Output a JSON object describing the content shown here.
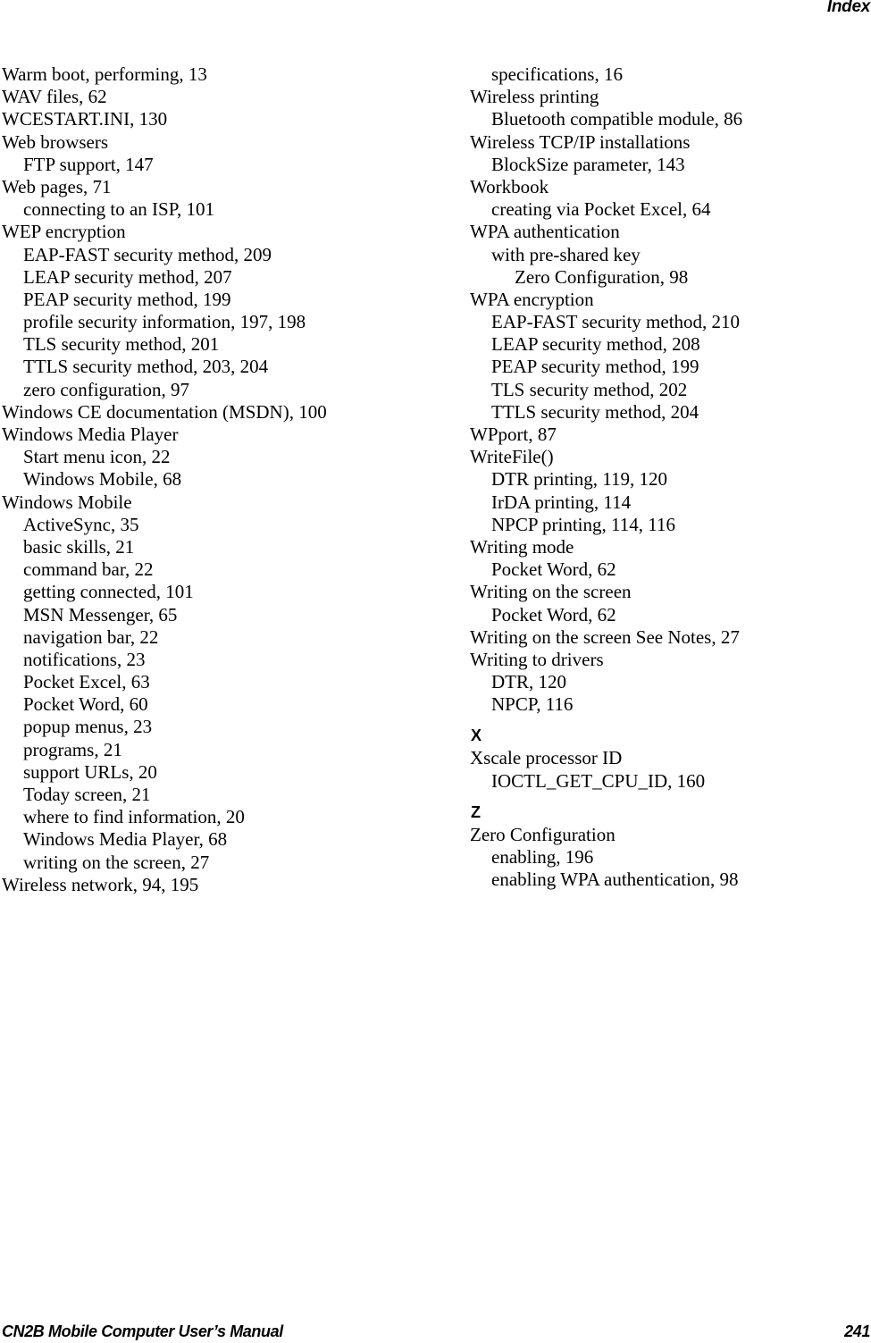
{
  "header": {
    "running_head": "Index"
  },
  "columns": [
    {
      "entries": [
        {
          "level": 1,
          "text": "Warm boot, performing, 13"
        },
        {
          "level": 1,
          "text": "WAV files, 62"
        },
        {
          "level": 1,
          "text": "WCESTART.INI, 130"
        },
        {
          "level": 1,
          "text": "Web browsers"
        },
        {
          "level": 2,
          "text": "FTP support, 147"
        },
        {
          "level": 1,
          "text": "Web pages, 71"
        },
        {
          "level": 2,
          "text": "connecting to an ISP, 101"
        },
        {
          "level": 1,
          "text": "WEP encryption"
        },
        {
          "level": 2,
          "text": "EAP-FAST security method, 209"
        },
        {
          "level": 2,
          "text": "LEAP security method, 207"
        },
        {
          "level": 2,
          "text": "PEAP security method, 199"
        },
        {
          "level": 2,
          "text": "profile security information, 197, 198"
        },
        {
          "level": 2,
          "text": "TLS security method, 201"
        },
        {
          "level": 2,
          "text": "TTLS security method, 203, 204"
        },
        {
          "level": 2,
          "text": "zero configuration, 97"
        },
        {
          "level": 1,
          "text": "Windows CE documentation (MSDN), 100"
        },
        {
          "level": 1,
          "text": "Windows Media Player"
        },
        {
          "level": 2,
          "text": "Start menu icon, 22"
        },
        {
          "level": 2,
          "text": "Windows Mobile, 68"
        },
        {
          "level": 1,
          "text": "Windows Mobile"
        },
        {
          "level": 2,
          "text": "ActiveSync, 35"
        },
        {
          "level": 2,
          "text": "basic skills, 21"
        },
        {
          "level": 2,
          "text": "command bar, 22"
        },
        {
          "level": 2,
          "text": "getting connected, 101"
        },
        {
          "level": 2,
          "text": "MSN Messenger, 65"
        },
        {
          "level": 2,
          "text": "navigation bar, 22"
        },
        {
          "level": 2,
          "text": "notifications, 23"
        },
        {
          "level": 2,
          "text": "Pocket Excel, 63"
        },
        {
          "level": 2,
          "text": "Pocket Word, 60"
        },
        {
          "level": 2,
          "text": "popup menus, 23"
        },
        {
          "level": 2,
          "text": "programs, 21"
        },
        {
          "level": 2,
          "text": "support URLs, 20"
        },
        {
          "level": 2,
          "text": "Today screen, 21"
        },
        {
          "level": 2,
          "text": "where to find information, 20"
        },
        {
          "level": 2,
          "text": "Windows Media Player, 68"
        },
        {
          "level": 2,
          "text": "writing on the screen, 27"
        },
        {
          "level": 1,
          "text": "Wireless network, 94, 195"
        }
      ]
    },
    {
      "entries": [
        {
          "level": 2,
          "text": "specifications, 16"
        },
        {
          "level": 1,
          "text": "Wireless printing"
        },
        {
          "level": 2,
          "text": "Bluetooth compatible module, 86"
        },
        {
          "level": 1,
          "text": "Wireless TCP/IP installations"
        },
        {
          "level": 2,
          "text": "BlockSize parameter, 143"
        },
        {
          "level": 1,
          "text": "Workbook"
        },
        {
          "level": 2,
          "text": "creating via Pocket Excel, 64"
        },
        {
          "level": 1,
          "text": "WPA authentication"
        },
        {
          "level": 2,
          "text": "with pre-shared key"
        },
        {
          "level": 3,
          "text": "Zero Configuration, 98"
        },
        {
          "level": 1,
          "text": "WPA encryption"
        },
        {
          "level": 2,
          "text": "EAP-FAST security method, 210"
        },
        {
          "level": 2,
          "text": "LEAP security method, 208"
        },
        {
          "level": 2,
          "text": "PEAP security method, 199"
        },
        {
          "level": 2,
          "text": "TLS security method, 202"
        },
        {
          "level": 2,
          "text": "TTLS security method, 204"
        },
        {
          "level": 1,
          "text": "WPport, 87"
        },
        {
          "level": 1,
          "text": "WriteFile()"
        },
        {
          "level": 2,
          "text": "DTR printing, 119, 120"
        },
        {
          "level": 2,
          "text": "IrDA printing, 114"
        },
        {
          "level": 2,
          "text": "NPCP printing, 114, 116"
        },
        {
          "level": 1,
          "text": "Writing mode"
        },
        {
          "level": 2,
          "text": "Pocket Word, 62"
        },
        {
          "level": 1,
          "text": "Writing on the screen"
        },
        {
          "level": 2,
          "text": "Pocket Word, 62"
        },
        {
          "level": 1,
          "text": "Writing on the screen See Notes, 27"
        },
        {
          "level": 1,
          "text": "Writing to drivers"
        },
        {
          "level": 2,
          "text": "DTR, 120"
        },
        {
          "level": 2,
          "text": "NPCP, 116"
        }
      ],
      "sections": [
        {
          "letter": "X",
          "entries": [
            {
              "level": 1,
              "text": "Xscale processor ID"
            },
            {
              "level": 2,
              "text": "IOCTL_GET_CPU_ID, 160"
            }
          ]
        },
        {
          "letter": "Z",
          "entries": [
            {
              "level": 1,
              "text": "Zero Configuration"
            },
            {
              "level": 2,
              "text": "enabling, 196"
            },
            {
              "level": 2,
              "text": "enabling WPA authentication, 98"
            }
          ]
        }
      ]
    }
  ],
  "footer": {
    "manual_title": "CN2B Mobile Computer User’s Manual",
    "page_number": "241"
  }
}
